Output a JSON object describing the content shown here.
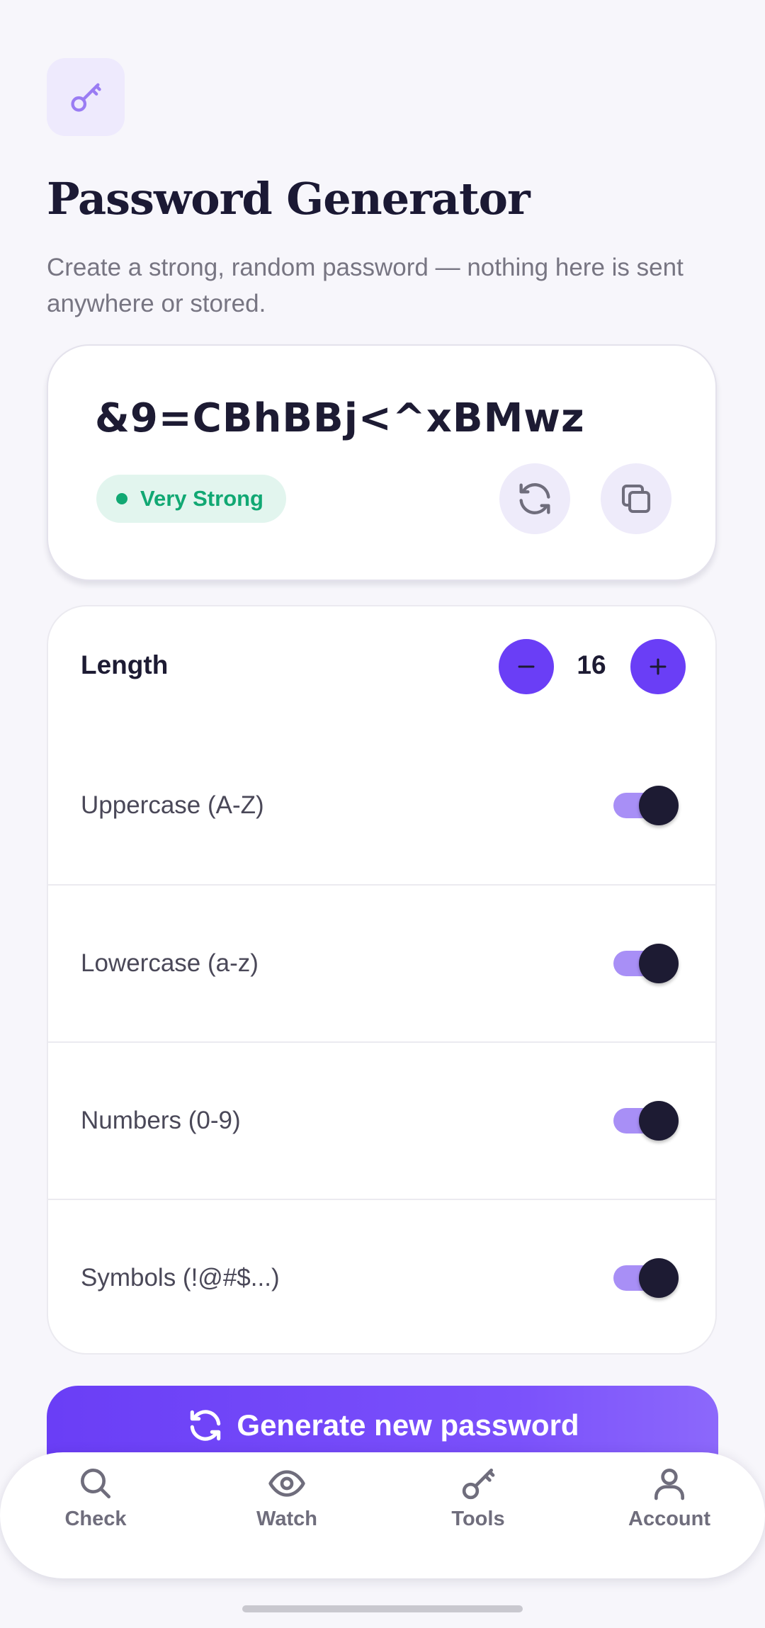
{
  "header": {
    "icon": "key-icon",
    "title": "Password Generator",
    "subtitle": "Create a strong, random password — nothing here is sent anywhere or stored."
  },
  "password": {
    "value": "&9=CBhBBj<^xBMwz",
    "strength": "Very Strong",
    "strength_color": "#11a873",
    "actions": [
      "refresh-icon",
      "copy-icon"
    ]
  },
  "options": {
    "length_label": "Length",
    "length_value": "16",
    "toggles": [
      {
        "label": "Uppercase (A-Z)",
        "on": true
      },
      {
        "label": "Lowercase (a-z)",
        "on": true
      },
      {
        "label": "Numbers (0-9)",
        "on": true
      },
      {
        "label": "Symbols (!@#$...)",
        "on": true
      }
    ]
  },
  "generate": {
    "label": "Generate new password"
  },
  "nav": {
    "items": [
      {
        "label": "Check",
        "icon": "search-icon"
      },
      {
        "label": "Watch",
        "icon": "eye-icon"
      },
      {
        "label": "Tools",
        "icon": "key-icon"
      },
      {
        "label": "Account",
        "icon": "user-icon"
      }
    ]
  },
  "colors": {
    "accent": "#6a3ef6",
    "background": "#f7f6fb",
    "text": "#1d1b33"
  }
}
